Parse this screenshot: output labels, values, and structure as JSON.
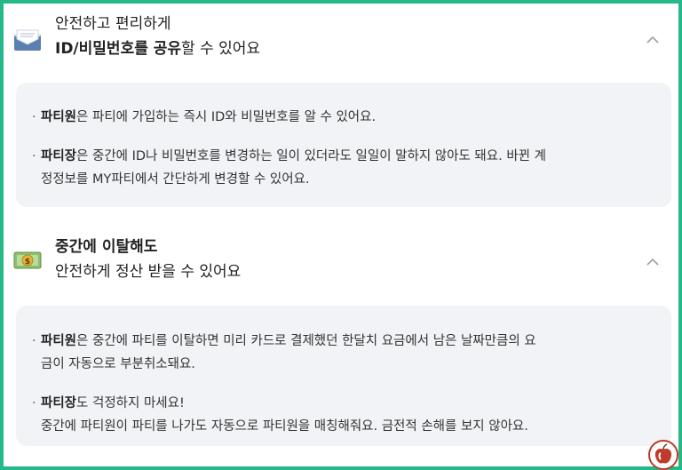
{
  "section1": {
    "icon": "envelope-icon",
    "line1": "안전하고 편리하게",
    "line2_bold": "ID/비밀번호를 공유",
    "line2_rest": "할 수 있어요",
    "items": [
      {
        "bold": "파티원",
        "text": "은 파티에 가입하는 즉시 ID와 비밀번호를 알 수 있어요."
      },
      {
        "bold": "파티장",
        "text": "은 중간에 ID나 비밀번호를 변경하는 일이 있더라도 일일이 말하지 않아도 돼요. 바뀐 계",
        "text2": "정정보를 MY파티에서 간단하게 변경할 수 있어요."
      }
    ]
  },
  "section2": {
    "icon": "money-icon",
    "line1": "중간에 이탈해도",
    "line2": "안전하게 정산 받을 수 있어요",
    "items": [
      {
        "bold": "파티원",
        "text": "은 중간에 파티를 이탈하면 미리 카드로 결제했던 한달치 요금에서 남은 날짜만큼의 요",
        "text2": "금이 자동으로 부분취소돼요."
      },
      {
        "bold": "파티장",
        "text": "도 걱정하지 마세요!",
        "text2": "중간에 파티원이 파티를 나가도 자동으로 파티원을 매칭해줘요. 금전적 손해를 보지 않아요."
      }
    ]
  },
  "colors": {
    "border": "#27b88a",
    "panel": "#f1f3f6"
  },
  "logo_icon": "apple-logo-icon"
}
